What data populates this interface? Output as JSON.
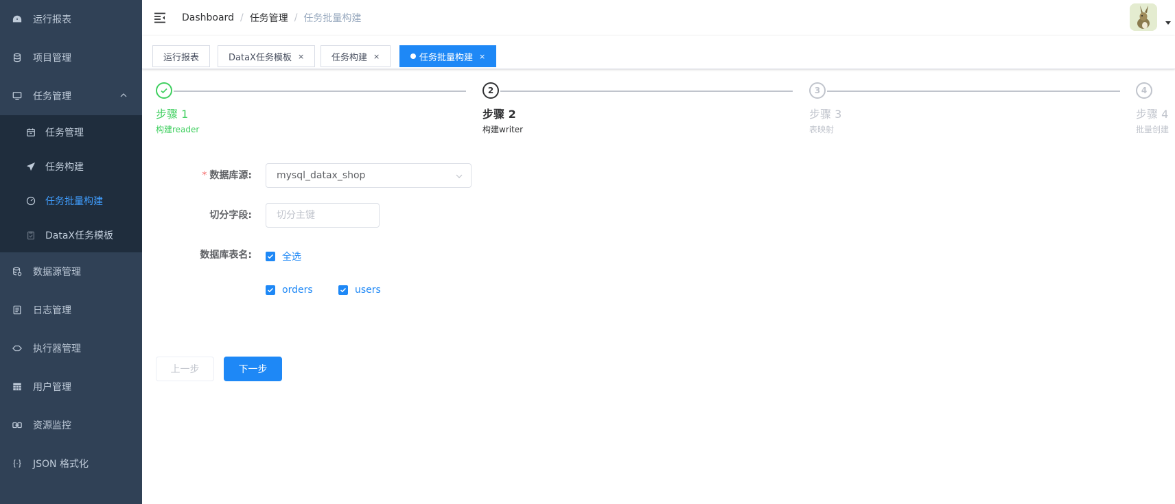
{
  "sidebar": {
    "items": [
      {
        "label": "运行报表",
        "icon": "dashboard-icon"
      },
      {
        "label": "项目管理",
        "icon": "database-icon"
      },
      {
        "label": "任务管理",
        "icon": "monitor-icon",
        "expanded": true
      },
      {
        "label": "数据源管理",
        "icon": "datasource-icon"
      },
      {
        "label": "日志管理",
        "icon": "document-icon"
      },
      {
        "label": "执行器管理",
        "icon": "executor-icon"
      },
      {
        "label": "用户管理",
        "icon": "table-icon"
      },
      {
        "label": "资源监控",
        "icon": "monitor-link-icon"
      },
      {
        "label": "JSON 格式化",
        "icon": "json-braces-icon"
      }
    ],
    "submenu": [
      {
        "label": "任务管理",
        "icon": "calendar-icon",
        "active": false
      },
      {
        "label": "任务构建",
        "icon": "paper-plane-icon",
        "active": false
      },
      {
        "label": "任务批量构建",
        "icon": "gauge-icon",
        "active": true
      },
      {
        "label": "DataX任务模板",
        "icon": "clipboard-icon",
        "active": false
      }
    ]
  },
  "breadcrumb": {
    "home": "Dashboard",
    "parent": "任务管理",
    "current": "任务批量构建",
    "separator": "/"
  },
  "tags": [
    {
      "label": "运行报表",
      "closable": false,
      "active": false
    },
    {
      "label": "DataX任务模板",
      "closable": true,
      "active": false
    },
    {
      "label": "任务构建",
      "closable": true,
      "active": false
    },
    {
      "label": "任务批量构建",
      "closable": true,
      "active": true
    }
  ],
  "tag_close_glyph": "×",
  "steps": [
    {
      "title": "步骤 1",
      "description": "构建reader",
      "status": "success",
      "number": ""
    },
    {
      "title": "步骤 2",
      "description": "构建writer",
      "status": "process",
      "number": "2"
    },
    {
      "title": "步骤 3",
      "description": "表映射",
      "status": "wait",
      "number": "3"
    },
    {
      "title": "步骤 4",
      "description": "批量创建",
      "status": "wait",
      "number": "4"
    }
  ],
  "form": {
    "datasource": {
      "label": "数据库源:",
      "required_mark": "*",
      "value": "mysql_datax_shop"
    },
    "split_field": {
      "label": "切分字段:",
      "placeholder": "切分主键",
      "value": ""
    },
    "tables": {
      "label": "数据库表名:",
      "select_all": {
        "label": "全选",
        "checked": true
      },
      "options": [
        {
          "label": "orders",
          "checked": true
        },
        {
          "label": "users",
          "checked": true
        }
      ]
    }
  },
  "buttons": {
    "prev": "上一步",
    "next": "下一步"
  },
  "colors": {
    "sidebar_bg": "#304156",
    "submenu_bg": "#1f2d3d",
    "primary": "#1e88f6",
    "success": "#3ecf5e",
    "menu_text": "#bfcbd9"
  }
}
